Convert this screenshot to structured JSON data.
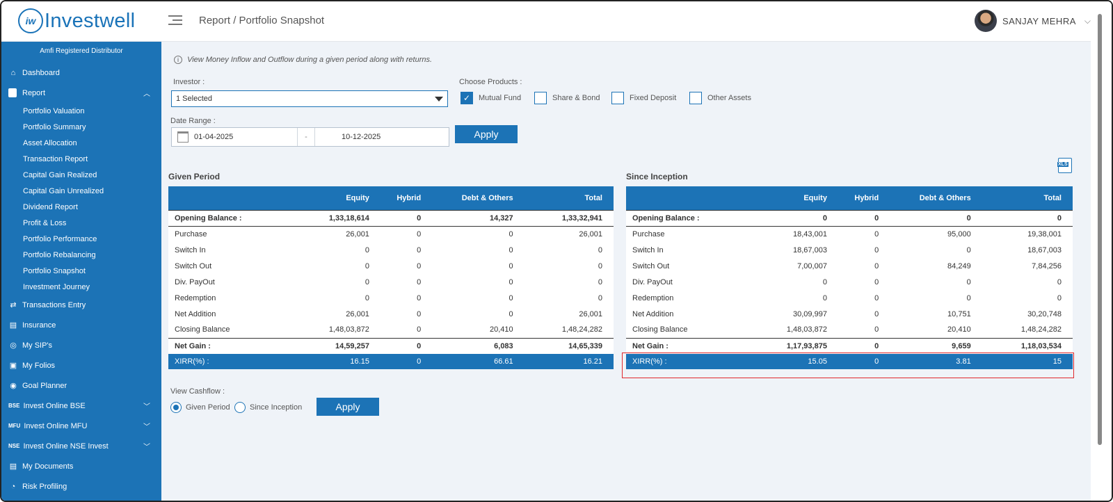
{
  "brand": {
    "logo_mark": "iw",
    "name": "Investwell"
  },
  "header": {
    "breadcrumb": "Report / Portfolio Snapshot",
    "user_name": "SANJAY MEHRA"
  },
  "sidebar": {
    "amfi": "Amfi Registered Distributor",
    "dashboard": "Dashboard",
    "report": "Report",
    "report_items": [
      "Portfolio Valuation",
      "Portfolio Summary",
      "Asset Allocation",
      "Transaction Report",
      "Capital Gain Realized",
      "Capital Gain Unrealized",
      "Dividend Report",
      "Profit & Loss",
      "Portfolio Performance",
      "Portfolio Rebalancing",
      "Portfolio Snapshot",
      "Investment Journey"
    ],
    "after": [
      {
        "label": "Transactions Entry",
        "icon": "⇄"
      },
      {
        "label": "Insurance",
        "icon": "▤"
      },
      {
        "label": "My SIP's",
        "icon": "◎"
      },
      {
        "label": "My Folios",
        "icon": "▣"
      },
      {
        "label": "Goal Planner",
        "icon": "◉"
      },
      {
        "label": "Invest Online BSE",
        "icon": "BSE",
        "chev": true
      },
      {
        "label": "Invest Online MFU",
        "icon": "MFU",
        "chev": true
      },
      {
        "label": "Invest Online NSE Invest",
        "icon": "NSE",
        "chev": true
      },
      {
        "label": "My Documents",
        "icon": "▤"
      },
      {
        "label": "Risk Profiling",
        "icon": "◔"
      }
    ]
  },
  "filters": {
    "info": "View Money Inflow and Outflow during a given period along with returns.",
    "investor_label": "Investor :",
    "investor_value": "1 Selected",
    "products_label": "Choose Products :",
    "products": [
      {
        "label": "Mutual Fund",
        "checked": true
      },
      {
        "label": "Share & Bond",
        "checked": false
      },
      {
        "label": "Fixed Deposit",
        "checked": false
      },
      {
        "label": "Other Assets",
        "checked": false
      }
    ],
    "date_label": "Date Range :",
    "date_from": "01-04-2025",
    "date_sep": "-",
    "date_to": "10-12-2025",
    "apply": "Apply"
  },
  "xls_label": "XLS",
  "given_period": {
    "title": "Given Period",
    "headers": [
      "",
      "Equity",
      "Hybrid",
      "Debt & Others",
      "Total"
    ],
    "rows": [
      [
        "Opening Balance :",
        "1,33,18,614",
        "0",
        "14,327",
        "1,33,32,941"
      ],
      [
        "Purchase",
        "26,001",
        "0",
        "0",
        "26,001"
      ],
      [
        "Switch In",
        "0",
        "0",
        "0",
        "0"
      ],
      [
        "Switch Out",
        "0",
        "0",
        "0",
        "0"
      ],
      [
        "Div. PayOut",
        "0",
        "0",
        "0",
        "0"
      ],
      [
        "Redemption",
        "0",
        "0",
        "0",
        "0"
      ],
      [
        "Net Addition",
        "26,001",
        "0",
        "0",
        "26,001"
      ],
      [
        "Closing Balance",
        "1,48,03,872",
        "0",
        "20,410",
        "1,48,24,282"
      ],
      [
        "Net Gain :",
        "14,59,257",
        "0",
        "6,083",
        "14,65,339"
      ],
      [
        "XIRR(%) :",
        "16.15",
        "0",
        "66.61",
        "16.21"
      ]
    ]
  },
  "since_inception": {
    "title": "Since Inception",
    "headers": [
      "",
      "Equity",
      "Hybrid",
      "Debt & Others",
      "Total"
    ],
    "rows": [
      [
        "Opening Balance :",
        "0",
        "0",
        "0",
        "0"
      ],
      [
        "Purchase",
        "18,43,001",
        "0",
        "95,000",
        "19,38,001"
      ],
      [
        "Switch In",
        "18,67,003",
        "0",
        "0",
        "18,67,003"
      ],
      [
        "Switch Out",
        "7,00,007",
        "0",
        "84,249",
        "7,84,256"
      ],
      [
        "Div. PayOut",
        "0",
        "0",
        "0",
        "0"
      ],
      [
        "Redemption",
        "0",
        "0",
        "0",
        "0"
      ],
      [
        "Net Addition",
        "30,09,997",
        "0",
        "10,751",
        "30,20,748"
      ],
      [
        "Closing Balance",
        "1,48,03,872",
        "0",
        "20,410",
        "1,48,24,282"
      ],
      [
        "Net Gain :",
        "1,17,93,875",
        "0",
        "9,659",
        "1,18,03,534"
      ],
      [
        "XIRR(%) :",
        "15.05",
        "0",
        "3.81",
        "15"
      ]
    ]
  },
  "cashflow": {
    "label": "View Cashflow :",
    "options": [
      {
        "label": "Given Period",
        "selected": true
      },
      {
        "label": "Since Inception",
        "selected": false
      }
    ],
    "apply": "Apply"
  },
  "colors": {
    "brand": "#1c73b6",
    "highlight": "#e0272b",
    "background": "#eff3f8"
  }
}
